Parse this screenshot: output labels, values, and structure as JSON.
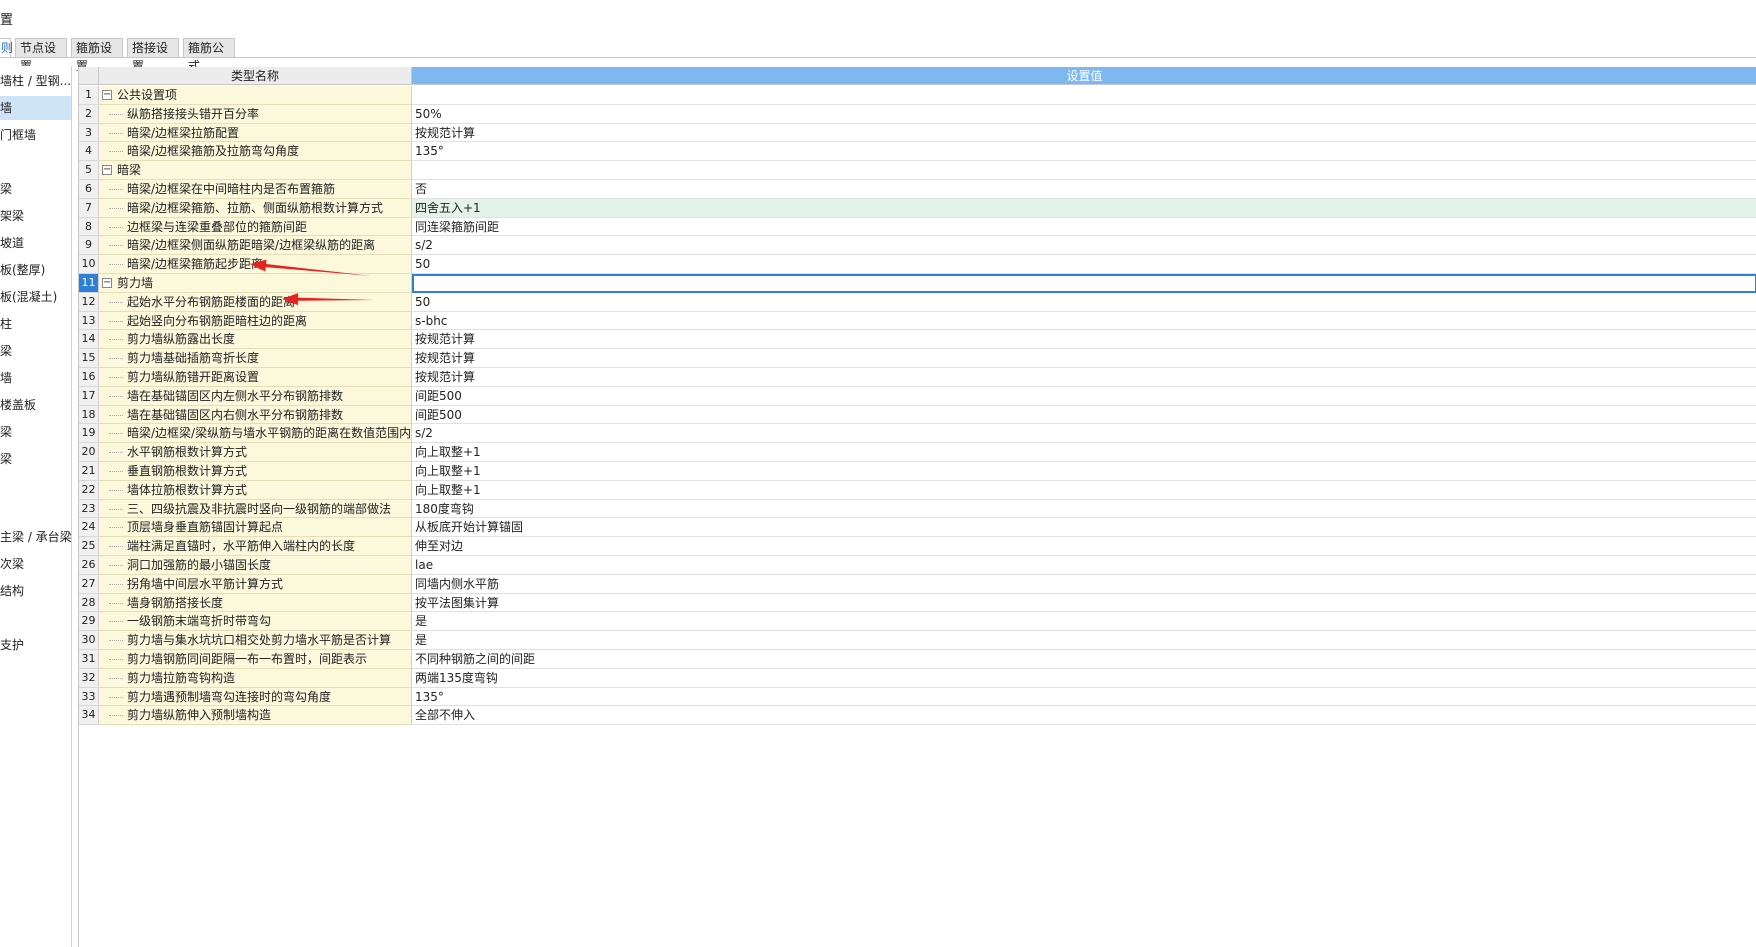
{
  "window": {
    "title": "置"
  },
  "tabs": [
    {
      "label": "则",
      "active": true
    },
    {
      "label": "节点设置",
      "active": false
    },
    {
      "label": "箍筋设置",
      "active": false
    },
    {
      "label": "搭接设置",
      "active": false
    },
    {
      "label": "箍筋公式",
      "active": false
    }
  ],
  "sidebar": {
    "items": [
      {
        "label": "墙柱 / 型钢...",
        "selected": false
      },
      {
        "label": "墙",
        "selected": true
      },
      {
        "label": "门框墙",
        "selected": false
      },
      {
        "label": "",
        "selected": false
      },
      {
        "label": "梁",
        "selected": false
      },
      {
        "label": "架梁",
        "selected": false
      },
      {
        "label": "坡道",
        "selected": false
      },
      {
        "label": "板(整厚)",
        "selected": false
      },
      {
        "label": "板(混凝土)",
        "selected": false
      },
      {
        "label": "柱",
        "selected": false
      },
      {
        "label": "梁",
        "selected": false
      },
      {
        "label": "墙",
        "selected": false
      },
      {
        "label": "楼盖板",
        "selected": false
      },
      {
        "label": "梁",
        "selected": false
      },
      {
        "label": "梁",
        "selected": false
      },
      {
        "label": "",
        "selected": false
      },
      {
        "label": "",
        "selected": false
      },
      {
        "label": "主梁 / 承台梁",
        "selected": false
      },
      {
        "label": "次梁",
        "selected": false
      },
      {
        "label": "结构",
        "selected": false
      },
      {
        "label": "",
        "selected": false
      },
      {
        "label": "支护",
        "selected": false
      }
    ]
  },
  "grid": {
    "header_name": "类型名称",
    "header_value": "设置值",
    "active_row": 11,
    "rows": [
      {
        "num": "1",
        "name": "公共设置项",
        "value": "",
        "group": true
      },
      {
        "num": "2",
        "name": "纵筋搭接接头错开百分率",
        "value": "50%"
      },
      {
        "num": "3",
        "name": "暗梁/边框梁拉筋配置",
        "value": "按规范计算"
      },
      {
        "num": "4",
        "name": "暗梁/边框梁箍筋及拉筋弯勾角度",
        "value": "135°"
      },
      {
        "num": "5",
        "name": "暗梁",
        "value": "",
        "group": true
      },
      {
        "num": "6",
        "name": "暗梁/边框梁在中间暗柱内是否布置箍筋",
        "value": "否"
      },
      {
        "num": "7",
        "name": "暗梁/边框梁箍筋、拉筋、侧面纵筋根数计算方式",
        "value": "四舍五入+1",
        "highlight": true
      },
      {
        "num": "8",
        "name": "边框梁与连梁重叠部位的箍筋间距",
        "value": "同连梁箍筋间距"
      },
      {
        "num": "9",
        "name": "暗梁/边框梁侧面纵筋距暗梁/边框梁纵筋的距离",
        "value": "s/2"
      },
      {
        "num": "10",
        "name": "暗梁/边框梁箍筋起步距离",
        "value": "50"
      },
      {
        "num": "11",
        "name": "剪力墙",
        "value": "",
        "group": true,
        "editing": true
      },
      {
        "num": "12",
        "name": "起始水平分布钢筋距楼面的距离",
        "value": "50"
      },
      {
        "num": "13",
        "name": "起始竖向分布钢筋距暗柱边的距离",
        "value": "s-bhc"
      },
      {
        "num": "14",
        "name": "剪力墙纵筋露出长度",
        "value": "按规范计算"
      },
      {
        "num": "15",
        "name": "剪力墙基础插筋弯折长度",
        "value": "按规范计算"
      },
      {
        "num": "16",
        "name": "剪力墙纵筋错开距离设置",
        "value": "按规范计算"
      },
      {
        "num": "17",
        "name": "墙在基础锚固区内左侧水平分布钢筋排数",
        "value": "间距500"
      },
      {
        "num": "18",
        "name": "墙在基础锚固区内右侧水平分布钢筋排数",
        "value": "间距500"
      },
      {
        "num": "19",
        "name": "暗梁/边框梁/梁纵筋与墙水平钢筋的距离在数值范围内不...",
        "value": "s/2"
      },
      {
        "num": "20",
        "name": "水平钢筋根数计算方式",
        "value": "向上取整+1"
      },
      {
        "num": "21",
        "name": "垂直钢筋根数计算方式",
        "value": "向上取整+1"
      },
      {
        "num": "22",
        "name": "墙体拉筋根数计算方式",
        "value": "向上取整+1"
      },
      {
        "num": "23",
        "name": "三、四级抗震及非抗震时竖向一级钢筋的端部做法",
        "value": "180度弯钩"
      },
      {
        "num": "24",
        "name": "顶层墙身垂直筋锚固计算起点",
        "value": "从板底开始计算锚固"
      },
      {
        "num": "25",
        "name": "端柱满足直锚时，水平筋伸入端柱内的长度",
        "value": "伸至对边"
      },
      {
        "num": "26",
        "name": "洞口加强筋的最小锚固长度",
        "value": "lae"
      },
      {
        "num": "27",
        "name": "拐角墙中间层水平筋计算方式",
        "value": "同墙内侧水平筋"
      },
      {
        "num": "28",
        "name": "墙身钢筋搭接长度",
        "value": "按平法图集计算"
      },
      {
        "num": "29",
        "name": "一级钢筋末端弯折时带弯勾",
        "value": "是"
      },
      {
        "num": "30",
        "name": "剪力墙与集水坑坑口相交处剪力墙水平筋是否计算",
        "value": "是"
      },
      {
        "num": "31",
        "name": "剪力墙钢筋同间距隔一布一布置时，间距表示",
        "value": "不同种钢筋之间的间距"
      },
      {
        "num": "32",
        "name": "剪力墙拉筋弯钩构造",
        "value": "两端135度弯钩"
      },
      {
        "num": "33",
        "name": "剪力墙遇预制墙弯勾连接时的弯勾角度",
        "value": "135°"
      },
      {
        "num": "34",
        "name": "剪力墙纵筋伸入预制墙构造",
        "value": "全部不伸入"
      }
    ]
  },
  "colors": {
    "header_value_bg": "#7db9f0",
    "name_cell_bg": "#fbf8dc",
    "highlight_bg": "#e3f3ea",
    "active_blue": "#2f7fd6",
    "annotation_red": "#e8231f"
  }
}
